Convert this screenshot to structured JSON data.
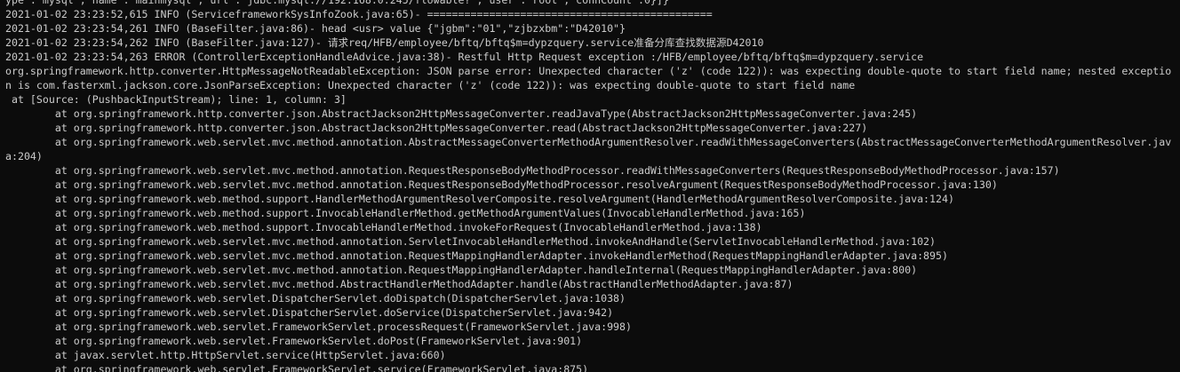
{
  "console": {
    "lines": [
      "ype\":\"mysql\",\"name\":\"mainmysql\",\"url\":\"jdbc:mysql://192.168.0.245/flowable?\",\"user\":\"root\",\"connCount\":0}]}",
      "2021-01-02 23:23:52,615 INFO (ServiceframeworkSysInfoZook.java:65)- ==============================================",
      "2021-01-02 23:23:54,261 INFO (BaseFilter.java:86)- head <usr> value {\"jgbm\":\"01\",\"zjbzxbm\":\"D42010\"}",
      "2021-01-02 23:23:54,262 INFO (BaseFilter.java:127)- 请求req/HFB/employee/bftq/bftq$m=dypzquery.service准备分库查找数据源D42010",
      "2021-01-02 23:23:54,263 ERROR (ControllerExceptionHandleAdvice.java:38)- Restful Http Request exception :/HFB/employee/bftq/bftq$m=dypzquery.service",
      "org.springframework.http.converter.HttpMessageNotReadableException: JSON parse error: Unexpected character ('z' (code 122)): was expecting double-quote to start field name; nested exceptio",
      "n is com.fasterxml.jackson.core.JsonParseException: Unexpected character ('z' (code 122)): was expecting double-quote to start field name",
      " at [Source: (PushbackInputStream); line: 1, column: 3]",
      "        at org.springframework.http.converter.json.AbstractJackson2HttpMessageConverter.readJavaType(AbstractJackson2HttpMessageConverter.java:245)",
      "        at org.springframework.http.converter.json.AbstractJackson2HttpMessageConverter.read(AbstractJackson2HttpMessageConverter.java:227)",
      "        at org.springframework.web.servlet.mvc.method.annotation.AbstractMessageConverterMethodArgumentResolver.readWithMessageConverters(AbstractMessageConverterMethodArgumentResolver.jav",
      "a:204)",
      "        at org.springframework.web.servlet.mvc.method.annotation.RequestResponseBodyMethodProcessor.readWithMessageConverters(RequestResponseBodyMethodProcessor.java:157)",
      "        at org.springframework.web.servlet.mvc.method.annotation.RequestResponseBodyMethodProcessor.resolveArgument(RequestResponseBodyMethodProcessor.java:130)",
      "        at org.springframework.web.method.support.HandlerMethodArgumentResolverComposite.resolveArgument(HandlerMethodArgumentResolverComposite.java:124)",
      "        at org.springframework.web.method.support.InvocableHandlerMethod.getMethodArgumentValues(InvocableHandlerMethod.java:165)",
      "        at org.springframework.web.method.support.InvocableHandlerMethod.invokeForRequest(InvocableHandlerMethod.java:138)",
      "        at org.springframework.web.servlet.mvc.method.annotation.ServletInvocableHandlerMethod.invokeAndHandle(ServletInvocableHandlerMethod.java:102)",
      "        at org.springframework.web.servlet.mvc.method.annotation.RequestMappingHandlerAdapter.invokeHandlerMethod(RequestMappingHandlerAdapter.java:895)",
      "        at org.springframework.web.servlet.mvc.method.annotation.RequestMappingHandlerAdapter.handleInternal(RequestMappingHandlerAdapter.java:800)",
      "        at org.springframework.web.servlet.mvc.method.AbstractHandlerMethodAdapter.handle(AbstractHandlerMethodAdapter.java:87)",
      "        at org.springframework.web.servlet.DispatcherServlet.doDispatch(DispatcherServlet.java:1038)",
      "        at org.springframework.web.servlet.DispatcherServlet.doService(DispatcherServlet.java:942)",
      "        at org.springframework.web.servlet.FrameworkServlet.processRequest(FrameworkServlet.java:998)",
      "        at org.springframework.web.servlet.FrameworkServlet.doPost(FrameworkServlet.java:901)",
      "        at javax.servlet.http.HttpServlet.service(HttpServlet.java:660)",
      "        at org.springframework.web.servlet.FrameworkServlet.service(FrameworkServlet.java:875)"
    ]
  },
  "colors": {
    "background": "#0c0c0c",
    "text": "#cccccc"
  }
}
